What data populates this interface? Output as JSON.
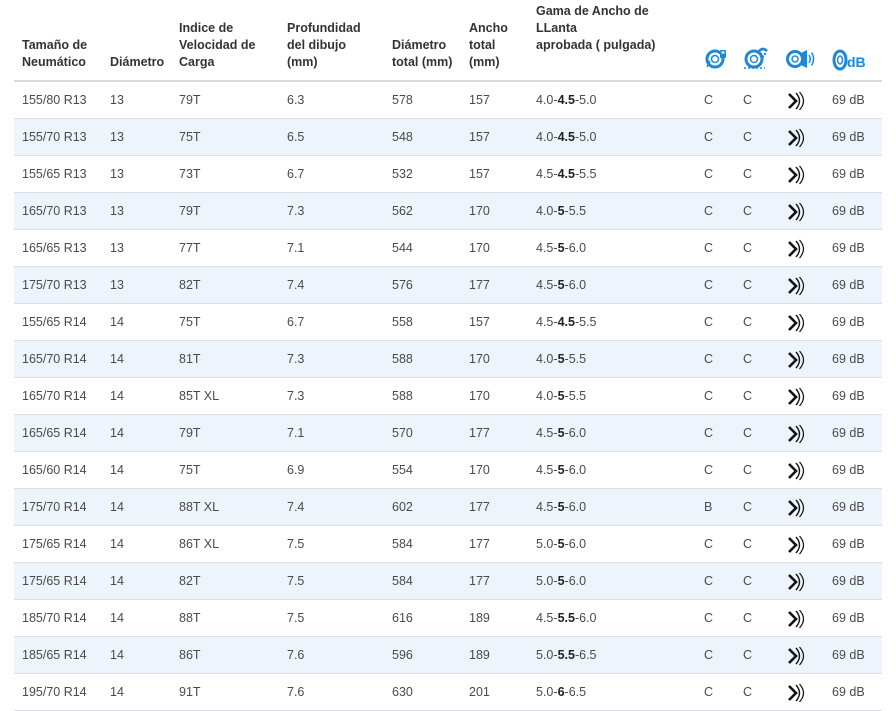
{
  "table": {
    "headers": {
      "size": [
        "Tamaño de",
        "Neumático"
      ],
      "diameter": [
        "Diámetro"
      ],
      "load_speed": [
        "Indice de",
        "Velocidad de",
        "Carga"
      ],
      "tread_depth": [
        "Profundidad",
        "del dibujo (mm)"
      ],
      "overall_diameter": [
        "Diámetro",
        "total (mm)"
      ],
      "overall_width": [
        "Ancho",
        "total",
        "(mm)"
      ],
      "rim_range": [
        "Gama de Ancho de LLanta",
        "aprobada ( pulgada)"
      ],
      "icon_fuel": "fuel-efficiency-icon",
      "icon_wet": "wet-grip-icon",
      "icon_noise": "external-noise-icon",
      "icon_db_label": "dB"
    },
    "rows": [
      {
        "size": "155/80 R13",
        "diameter": "13",
        "load_speed": "79T",
        "tread": "6.3",
        "overall_diameter": "578",
        "width": "157",
        "rim_min": "4.0",
        "rim_opt": "4.5",
        "rim_max": "5.0",
        "fuel": "C",
        "wet": "C",
        "noise": "69 dB"
      },
      {
        "size": "155/70 R13",
        "diameter": "13",
        "load_speed": "75T",
        "tread": "6.5",
        "overall_diameter": "548",
        "width": "157",
        "rim_min": "4.0",
        "rim_opt": "4.5",
        "rim_max": "5.0",
        "fuel": "C",
        "wet": "C",
        "noise": "69 dB"
      },
      {
        "size": "155/65 R13",
        "diameter": "13",
        "load_speed": "73T",
        "tread": "6.7",
        "overall_diameter": "532",
        "width": "157",
        "rim_min": "4.5",
        "rim_opt": "4.5",
        "rim_max": "5.5",
        "fuel": "C",
        "wet": "C",
        "noise": "69 dB"
      },
      {
        "size": "165/70 R13",
        "diameter": "13",
        "load_speed": "79T",
        "tread": "7.3",
        "overall_diameter": "562",
        "width": "170",
        "rim_min": "4.0",
        "rim_opt": "5",
        "rim_max": "5.5",
        "fuel": "C",
        "wet": "C",
        "noise": "69 dB"
      },
      {
        "size": "165/65 R13",
        "diameter": "13",
        "load_speed": "77T",
        "tread": "7.1",
        "overall_diameter": "544",
        "width": "170",
        "rim_min": "4.5",
        "rim_opt": "5",
        "rim_max": "6.0",
        "fuel": "C",
        "wet": "C",
        "noise": "69 dB"
      },
      {
        "size": "175/70 R13",
        "diameter": "13",
        "load_speed": "82T",
        "tread": "7.4",
        "overall_diameter": "576",
        "width": "177",
        "rim_min": "4.5",
        "rim_opt": "5",
        "rim_max": "6.0",
        "fuel": "C",
        "wet": "C",
        "noise": "69 dB"
      },
      {
        "size": "155/65 R14",
        "diameter": "14",
        "load_speed": "75T",
        "tread": "6.7",
        "overall_diameter": "558",
        "width": "157",
        "rim_min": "4.5",
        "rim_opt": "4.5",
        "rim_max": "5.5",
        "fuel": "C",
        "wet": "C",
        "noise": "69 dB"
      },
      {
        "size": "165/70 R14",
        "diameter": "14",
        "load_speed": "81T",
        "tread": "7.3",
        "overall_diameter": "588",
        "width": "170",
        "rim_min": "4.0",
        "rim_opt": "5",
        "rim_max": "5.5",
        "fuel": "C",
        "wet": "C",
        "noise": "69 dB"
      },
      {
        "size": "165/70 R14",
        "diameter": "14",
        "load_speed": "85T XL",
        "tread": "7.3",
        "overall_diameter": "588",
        "width": "170",
        "rim_min": "4.0",
        "rim_opt": "5",
        "rim_max": "5.5",
        "fuel": "C",
        "wet": "C",
        "noise": "69 dB"
      },
      {
        "size": "165/65 R14",
        "diameter": "14",
        "load_speed": "79T",
        "tread": "7.1",
        "overall_diameter": "570",
        "width": "177",
        "rim_min": "4.5",
        "rim_opt": "5",
        "rim_max": "6.0",
        "fuel": "C",
        "wet": "C",
        "noise": "69 dB"
      },
      {
        "size": "165/60 R14",
        "diameter": "14",
        "load_speed": "75T",
        "tread": "6.9",
        "overall_diameter": "554",
        "width": "170",
        "rim_min": "4.5",
        "rim_opt": "5",
        "rim_max": "6.0",
        "fuel": "C",
        "wet": "C",
        "noise": "69 dB"
      },
      {
        "size": "175/70 R14",
        "diameter": "14",
        "load_speed": "88T XL",
        "tread": "7.4",
        "overall_diameter": "602",
        "width": "177",
        "rim_min": "4.5",
        "rim_opt": "5",
        "rim_max": "6.0",
        "fuel": "B",
        "wet": "C",
        "noise": "69 dB"
      },
      {
        "size": "175/65 R14",
        "diameter": "14",
        "load_speed": "86T XL",
        "tread": "7.5",
        "overall_diameter": "584",
        "width": "177",
        "rim_min": "5.0",
        "rim_opt": "5",
        "rim_max": "6.0",
        "fuel": "C",
        "wet": "C",
        "noise": "69 dB"
      },
      {
        "size": "175/65 R14",
        "diameter": "14",
        "load_speed": "82T",
        "tread": "7.5",
        "overall_diameter": "584",
        "width": "177",
        "rim_min": "5.0",
        "rim_opt": "5",
        "rim_max": "6.0",
        "fuel": "C",
        "wet": "C",
        "noise": "69 dB"
      },
      {
        "size": "185/70 R14",
        "diameter": "14",
        "load_speed": "88T",
        "tread": "7.5",
        "overall_diameter": "616",
        "width": "189",
        "rim_min": "4.5",
        "rim_opt": "5.5",
        "rim_max": "6.0",
        "fuel": "C",
        "wet": "C",
        "noise": "69 dB"
      },
      {
        "size": "185/65 R14",
        "diameter": "14",
        "load_speed": "86T",
        "tread": "7.6",
        "overall_diameter": "596",
        "width": "189",
        "rim_min": "5.0",
        "rim_opt": "5.5",
        "rim_max": "6.5",
        "fuel": "C",
        "wet": "C",
        "noise": "69 dB"
      },
      {
        "size": "195/70 R14",
        "diameter": "14",
        "load_speed": "91T",
        "tread": "7.6",
        "overall_diameter": "630",
        "width": "201",
        "rim_min": "5.0",
        "rim_opt": "6",
        "rim_max": "6.5",
        "fuel": "C",
        "wet": "C",
        "noise": "69 dB"
      }
    ]
  },
  "colors": {
    "accent": "#1e88d8",
    "zebra": "#eef4fb",
    "text": "#4a4a4a",
    "header_text": "#333333",
    "row_border": "#dcdfe3"
  }
}
